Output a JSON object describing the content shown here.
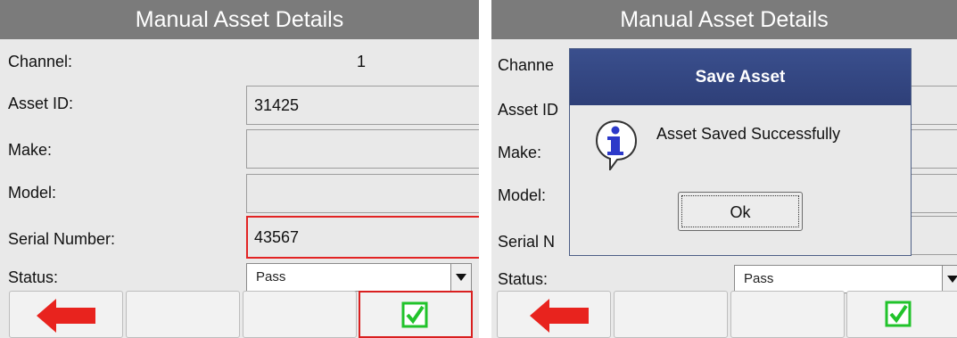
{
  "left": {
    "title": "Manual Asset Details",
    "channel_label": "Channel:",
    "channel_value": "1",
    "asset_id_label": "Asset ID:",
    "asset_id_value": "31425",
    "make_label": "Make:",
    "make_value": "",
    "model_label": "Model:",
    "model_value": "",
    "serial_label": "Serial Number:",
    "serial_value": "43567",
    "status_label": "Status:",
    "status_value": "Pass"
  },
  "right": {
    "title": "Manual Asset Details",
    "channel_label": "Channe",
    "asset_id_label": "Asset ID",
    "make_label": "Make:",
    "model_label": "Model:",
    "serial_label": "Serial N",
    "status_label": "Status:",
    "status_value": "Pass"
  },
  "dialog": {
    "title": "Save Asset",
    "message": "Asset Saved Successfully",
    "ok_label": "Ok",
    "icon": "info-icon"
  },
  "toolbar_icons": {
    "back": "back-arrow-icon",
    "save": "checkmark-icon"
  },
  "colors": {
    "title_bar": "#7b7b7b",
    "panel_bg": "#e9e9e9",
    "focus_border": "#e22424",
    "back_arrow": "#e8231e",
    "check": "#21c32b",
    "dialog_title": "#34478a"
  }
}
